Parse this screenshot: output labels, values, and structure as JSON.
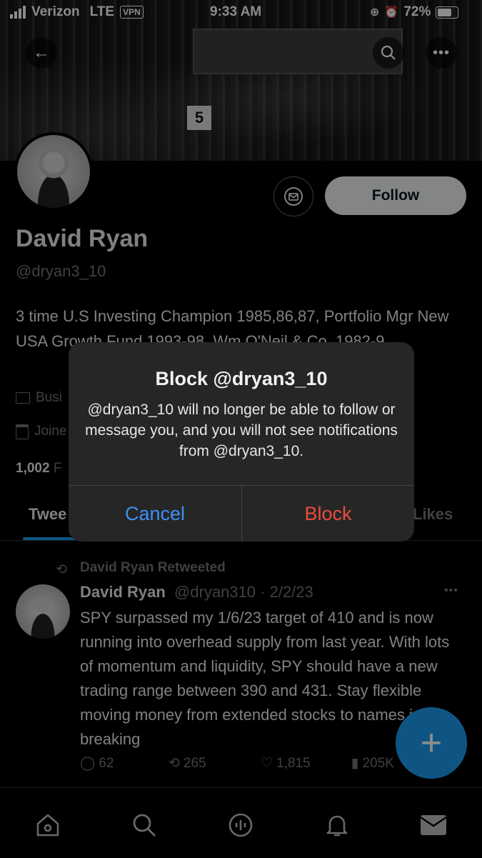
{
  "status_bar": {
    "carrier": "Verizon",
    "network": "LTE",
    "vpn": "VPN",
    "time": "9:33 AM",
    "battery": "72%"
  },
  "profile": {
    "name": "David Ryan",
    "handle": "@dryan3_10",
    "bio": "3 time U.S Investing Champion 1985,86,87, Portfolio Mgr New USA Growth Fund 1993-98, Wm O'Neil & Co. 1982-9",
    "category": "Busi",
    "joined": "Joine",
    "following_count": "1,002",
    "following_label": "F",
    "follow_label": "Follow"
  },
  "tabs": {
    "tweets": "Twee",
    "likes": "Likes"
  },
  "dialog": {
    "title": "Block @dryan3_10",
    "body": "@dryan3_10 will no longer be able to follow or message you, and you will not see notifications from @dryan3_10.",
    "cancel": "Cancel",
    "block": "Block"
  },
  "tweet": {
    "retweeted_by": "David Ryan Retweeted",
    "author": "David Ryan",
    "handle": "@dryan310",
    "date": "· 2/2/23",
    "text": "SPY surpassed my 1/6/23 target of 410 and is now running into overhead supply from last year. With lots of momentum and liquidity, SPY should have a new trading range between 390 and 431. Stay flexible moving money from extended stocks to names just breaking",
    "replies": "62",
    "retweets": "265",
    "likes": "1,815",
    "views": "205K"
  },
  "banner_number": "5",
  "colors": {
    "accent": "#1d9bf0",
    "block": "#eb4b3f",
    "cancel": "#3d8ff5",
    "dialog_bg": "#262626"
  }
}
